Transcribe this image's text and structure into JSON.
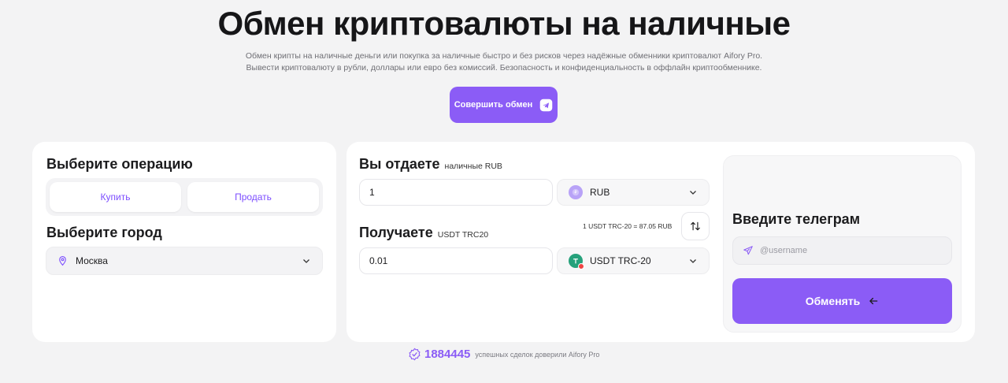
{
  "hero": {
    "title": "Обмен криптовалюты на наличные",
    "subtitle_line1": "Обмен крипты на наличные деньги или покупка за наличные быстро и без рисков через надёжные обменники криптовалют Aifory Pro.",
    "subtitle_line2": "Вывести криптовалюту в рубли, доллары или евро без комиссий. Безопасность и конфиденциальность в оффлайн криптообменнике.",
    "cta_label": "Совершить обмен"
  },
  "operation": {
    "heading": "Выберите операцию",
    "buy_label": "Купить",
    "sell_label": "Продать"
  },
  "city": {
    "heading": "Выберите город",
    "selected": "Москва"
  },
  "give": {
    "heading": "Вы отдаете",
    "note": "наличные RUB",
    "amount": "1",
    "currency": "RUB"
  },
  "receive": {
    "heading": "Получаете",
    "note": "USDT TRC20",
    "amount": "0.01",
    "currency": "USDT TRC-20"
  },
  "rate_text": "1 USDT TRC-20 = 87.05 RUB",
  "telegram": {
    "heading": "Введите телеграм",
    "placeholder": "@username"
  },
  "exchange_label": "Обменять",
  "stats": {
    "count": "1884445",
    "text": "успешных сделок доверили Aifory Pro"
  },
  "colors": {
    "accent": "#8b5cf6",
    "background": "#f3f3f4",
    "tether": "#26a17b"
  }
}
